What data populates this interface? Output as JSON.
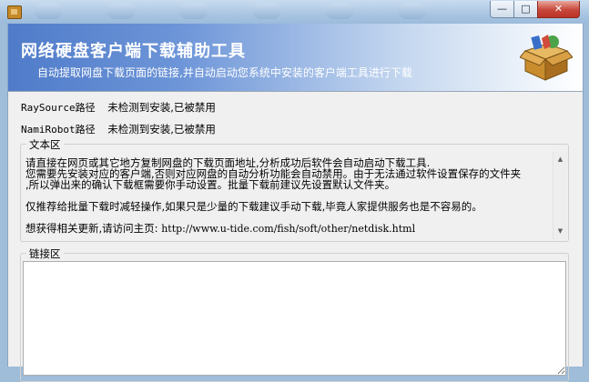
{
  "window": {
    "minimize_glyph": "—",
    "maximize_glyph": "□",
    "close_glyph": "✕"
  },
  "banner": {
    "title": "网络硬盘客户端下载辅助工具",
    "subtitle": "自动提取网盘下载页面的链接,并自动启动您系统中安装的客户端工具进行下载",
    "icon": "package-box-icon"
  },
  "paths": [
    {
      "label": "RaySource路径",
      "status": "未检测到安装,已被禁用"
    },
    {
      "label": "NamiRobot路径",
      "status": "未检测到安装,已被禁用"
    }
  ],
  "text_area": {
    "legend": "文本区",
    "lines": [
      "请直接在网页或其它地方复制网盘的下载页面地址,分析成功后软件会自动启动下载工具.",
      "您需要先安装对应的客户端,否则对应网盘的自动分析功能会自动禁用。由于无法通过软件设置保存的文件夹",
      ",所以弹出来的确认下载框需要你手动设置。批量下载前建议先设置默认文件夹。",
      "",
      "仅推荐给批量下载时减轻操作,如果只是少量的下载建议手动下载,毕竟人家提供服务也是不容易的。",
      "",
      "想获得相关更新,请访问主页:",
      "http://www.u-tide.com/fish/soft/other/netdisk.html"
    ],
    "scroll_up": "▲",
    "scroll_down": "▼"
  },
  "links_area": {
    "legend": "链接区",
    "value": ""
  },
  "colors": {
    "banner_start": "#4f7bc9",
    "banner_end": "#ffffff",
    "close_button": "#c8473a"
  }
}
